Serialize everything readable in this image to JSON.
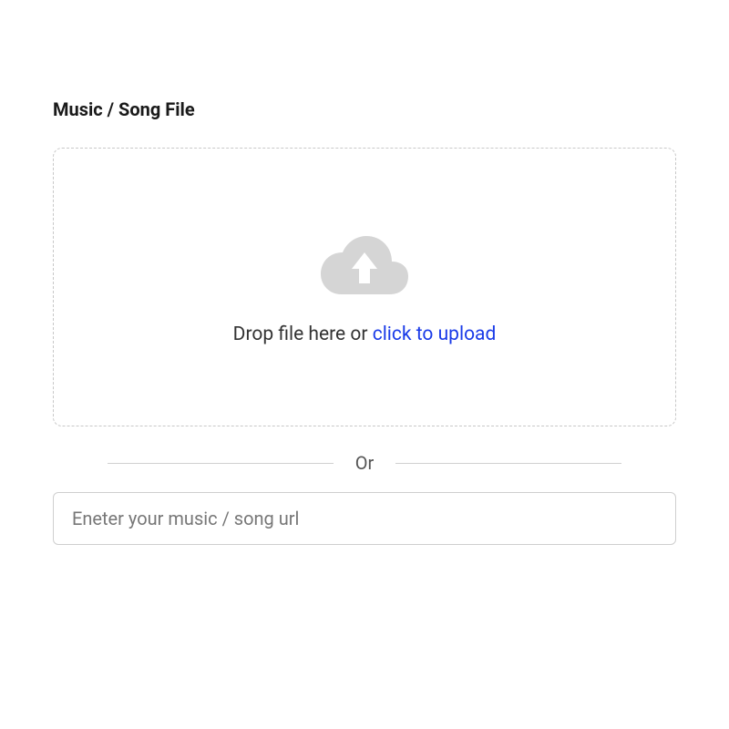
{
  "section": {
    "title": "Music / Song File"
  },
  "dropzone": {
    "text_prefix": "Drop file here or ",
    "link_text": "click to upload"
  },
  "divider": {
    "label": "Or"
  },
  "url_input": {
    "placeholder": "Eneter your music / song url",
    "value": ""
  },
  "icons": {
    "upload": "cloud-upload-icon"
  },
  "colors": {
    "link": "#1a3be8",
    "border": "#cfcfcf",
    "icon": "#d5d5d5"
  }
}
